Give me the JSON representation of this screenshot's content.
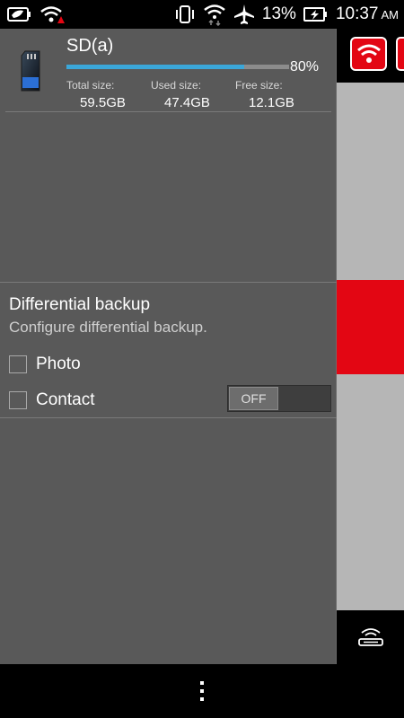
{
  "status_bar": {
    "battery_percent": "13%",
    "time": "10:37",
    "ampm": "AM",
    "icons": [
      "battery-saver-icon",
      "wifi-warning-icon",
      "vibrate-icon",
      "wifi-transfer-icon",
      "airplane-mode-icon",
      "battery-charging-icon"
    ]
  },
  "storage": {
    "name": "SD(a)",
    "usage_percent": "80%",
    "usage_fraction": 0.8,
    "total_label": "Total size:",
    "total_value": "59.5GB",
    "used_label": "Used size:",
    "used_value": "47.4GB",
    "free_label": "Free size:",
    "free_value": "12.1GB"
  },
  "differential_backup": {
    "title": "Differential backup",
    "subtitle": "Configure differential backup.",
    "options": [
      {
        "label": "Photo",
        "checked": false
      },
      {
        "label": "Contact",
        "checked": false
      }
    ],
    "toggle_label": "OFF"
  },
  "colors": {
    "drawer_bg": "#595959",
    "accent_bar": "#3ba7d9",
    "brand_red": "#e30613",
    "panel_grey": "#b6b6b6"
  }
}
